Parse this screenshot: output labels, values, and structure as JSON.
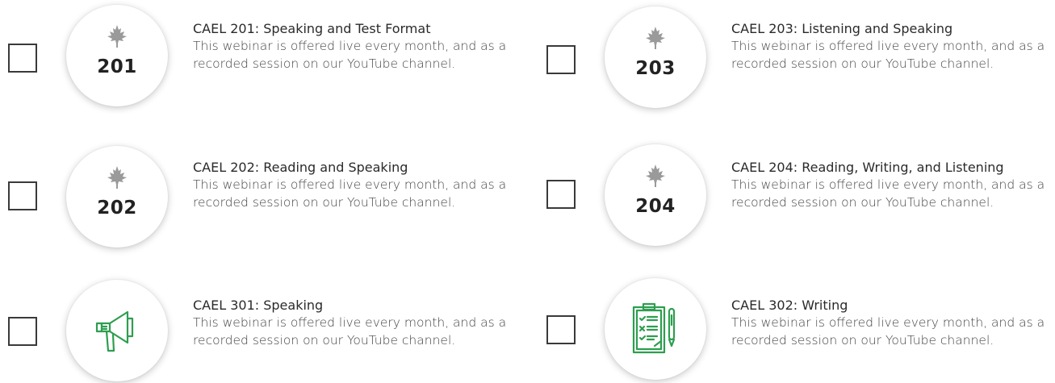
{
  "colors": {
    "accent_green": "#2e9e4f",
    "leaf_gray": "#9a9a9a",
    "border": "#3a3a3a"
  },
  "webinars": [
    {
      "id": "201",
      "code": "201",
      "icon": "maple-leaf-icon",
      "title": "CAEL 201: Speaking and Test Format",
      "description": "This webinar is offered live every month, and as a recorded session on our YouTube channel.",
      "checked": false
    },
    {
      "id": "203",
      "code": "203",
      "icon": "maple-leaf-icon",
      "title": "CAEL 203: Listening and Speaking",
      "description": "This webinar is offered live every month, and as a recorded session on our YouTube channel.",
      "checked": false
    },
    {
      "id": "202",
      "code": "202",
      "icon": "maple-leaf-icon",
      "title": "CAEL 202: Reading and Speaking",
      "description": "This webinar is offered live every month, and as a recorded session on our YouTube channel.",
      "checked": false
    },
    {
      "id": "204",
      "code": "204",
      "icon": "maple-leaf-icon",
      "title": "CAEL 204: Reading, Writing, and Listening",
      "description": "This webinar is offered live every month, and as a recorded session on our YouTube channel.",
      "checked": false
    },
    {
      "id": "301",
      "code": "",
      "icon": "megaphone-icon",
      "title": "CAEL 301: Speaking",
      "description": "This webinar is offered live every month, and as a recorded session on our YouTube channel.",
      "checked": false
    },
    {
      "id": "302",
      "code": "",
      "icon": "clipboard-checklist-icon",
      "title": "CAEL 302: Writing",
      "description": "This webinar is offered live every month, and as a recorded session on our YouTube channel.",
      "checked": false
    }
  ]
}
